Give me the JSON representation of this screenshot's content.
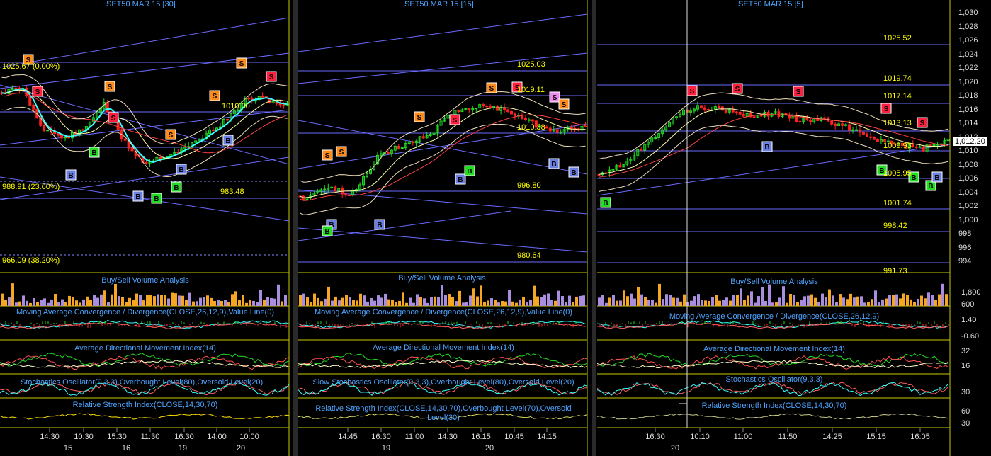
{
  "panels": [
    {
      "title": "SET50 MAR 15   [30]",
      "price_labels": [
        "1025.67 (0.00%)",
        "1010.00",
        "988.91 (23.60%)",
        "983.48",
        "966.09 (38.20%)"
      ],
      "indicators": [
        "Buy/Sell Volume Analysis",
        "Moving Average Convergence / Divergence(CLOSE,26,12,9),Value Line(0)",
        "Average Directional Movement Index(14)",
        "Stochastics Oscillator(9,3,3),Overbought Level(80),Oversold Level(20)",
        "Relative Strength Index(CLOSE,14,30,70)"
      ],
      "time_ticks": [
        "14:30",
        "10:30",
        "15:30",
        "11:30",
        "16:30",
        "14:00",
        "10:00"
      ],
      "date_ticks": [
        "15",
        "16",
        "19",
        "20"
      ]
    },
    {
      "title": "SET50 MAR 15   [15]",
      "price_labels": [
        "1025.03",
        "1019.11",
        "1010.38",
        "996.80",
        "980.64"
      ],
      "indicators": [
        "Buy/Sell Volume Analysis",
        "Moving Average Convergence / Divergence(CLOSE,26,12,9),Value Line(0)",
        "Average Directional Movement Index(14)",
        "Slow Stochastics Oscillator(9,3,3),Overbought Level(80),Oversold Level(20)",
        "Relative Strength Index(CLOSE,14,30,70),Overbought Level(70),Oversold Level(30)"
      ],
      "time_ticks": [
        "14:45",
        "16:30",
        "11:00",
        "14:30",
        "16:15",
        "10:45",
        "14:15"
      ],
      "date_ticks": [
        "19",
        "20"
      ]
    },
    {
      "title": "SET50 MAR 15   [5]",
      "price_labels": [
        "1025.52",
        "1019.74",
        "1017.14",
        "1013.13",
        "1009.93",
        "1005.95",
        "1001.74",
        "998.42",
        "991.73"
      ],
      "indicators": [
        "Buy/Sell Volume Analysis",
        "Moving Average Convergence / Divergence(CLOSE,26,12,9)",
        "Average Directional Movement Index(14)",
        "Stochastics Oscillator(9,3,3)",
        "Relative Strength Index(CLOSE,14,30,70)"
      ],
      "time_ticks": [
        "16:30",
        "10:10",
        "11:00",
        "11:50",
        "14:25",
        "15:15",
        "16:05"
      ],
      "date_ticks": [
        "20"
      ],
      "price_axis": [
        "1,030",
        "1,028",
        "1,026",
        "1,024",
        "1,022",
        "1,020",
        "1,018",
        "1,016",
        "1,014",
        "1,012",
        "1,010",
        "1,008",
        "1,006",
        "1,004",
        "1,002",
        "1,000",
        "998",
        "996",
        "994"
      ],
      "last_price": "1,012.20",
      "volume_axis": [
        "1,800",
        "600"
      ],
      "macd_axis": [
        "1.40",
        "-0.60"
      ],
      "adx_axis": [
        "32",
        "16"
      ],
      "stoch_axis": [
        "30"
      ],
      "rsi_axis": [
        "60",
        "30"
      ]
    }
  ],
  "markers": {
    "sell": "S",
    "buy": "B"
  },
  "colors": {
    "background": "#000000",
    "title": "#4da3ff",
    "levels": "#ffff00",
    "sell_orange": "#ff8c1a",
    "sell_red": "#ff2040",
    "buy_blue": "#6b7fe0",
    "buy_green": "#22dd22",
    "cyan_line": "#33ffff"
  }
}
